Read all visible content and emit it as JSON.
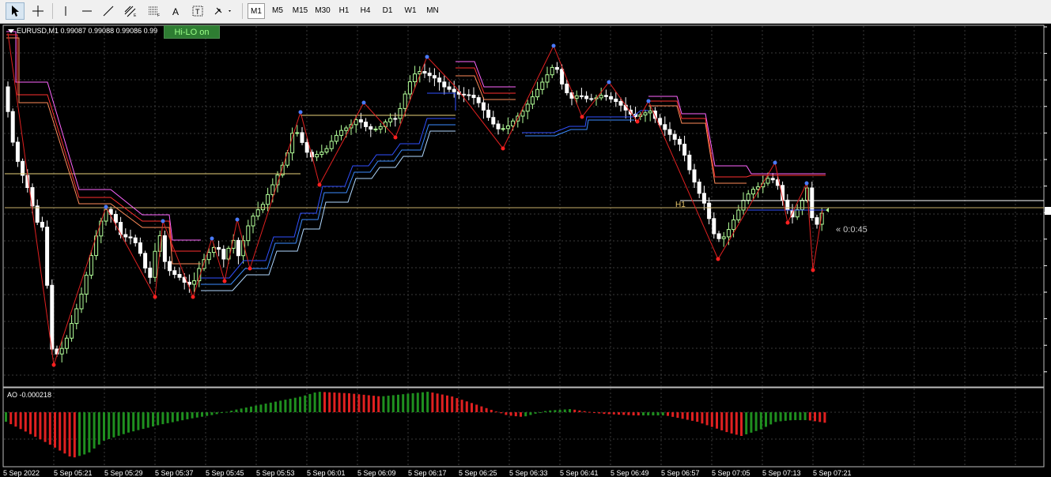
{
  "toolbar": {
    "tools": [
      {
        "name": "cursor-tool",
        "icon": "arrow-cursor-icon",
        "active": true
      },
      {
        "name": "crosshair-tool",
        "icon": "crosshair-icon",
        "active": false
      },
      {
        "name": "vertical-line-tool",
        "icon": "vertical-line-icon",
        "active": false
      },
      {
        "name": "horizontal-line-tool",
        "icon": "horizontal-line-icon",
        "active": false
      },
      {
        "name": "trendline-tool",
        "icon": "trendline-icon",
        "active": false
      },
      {
        "name": "equidistant-channel-tool",
        "icon": "equidistant-channel-icon",
        "active": false
      },
      {
        "name": "fibonacci-tool",
        "icon": "fibonacci-retracement-icon",
        "active": false
      },
      {
        "name": "text-tool",
        "icon": "text-icon",
        "active": false
      },
      {
        "name": "text-label-tool",
        "icon": "text-label-icon",
        "active": false
      },
      {
        "name": "arrows-tool",
        "icon": "arrows-dropdown-icon",
        "active": false
      }
    ],
    "timeframes": [
      "M1",
      "M5",
      "M15",
      "M30",
      "H1",
      "H4",
      "D1",
      "W1",
      "MN"
    ],
    "active_timeframe": "M1"
  },
  "chart": {
    "symbol_label": "EURUSD,M1  0.99087 0.99088 0.99086 0.99",
    "hilo_badge": "Hi-LO on",
    "h1_label": "H1",
    "timer_label": "« 0:0:45",
    "ao_label": "AO -0.000218",
    "date_labels": [
      "5 Sep 2022",
      "5 Sep 05:21",
      "5 Sep 05:29",
      "5 Sep 05:37",
      "5 Sep 05:45",
      "5 Sep 05:53",
      "5 Sep 06:01",
      "5 Sep 06:09",
      "5 Sep 06:17",
      "5 Sep 06:25",
      "5 Sep 06:33",
      "5 Sep 06:41",
      "5 Sep 06:49",
      "5 Sep 06:57",
      "5 Sep 07:05",
      "5 Sep 07:13",
      "5 Sep 07:21"
    ],
    "colors": {
      "background": "#000000",
      "grid": "#3a3a3a",
      "candle_bull": "#b4ff9a",
      "candle_bear": "#ffffff",
      "zigzag": "#e02020",
      "swing_low_dot": "#ff2020",
      "swing_high_dot": "#4a7bff",
      "resistance_lines": [
        "#ff66ff",
        "#ff3030",
        "#ff8c5a"
      ],
      "support_lines": [
        "#3050ff",
        "#3c8cff",
        "#b0d8ff"
      ],
      "yellow_line": "#e8d27a",
      "ao_up": "#1f8f1f",
      "ao_down": "#e02020"
    }
  }
}
